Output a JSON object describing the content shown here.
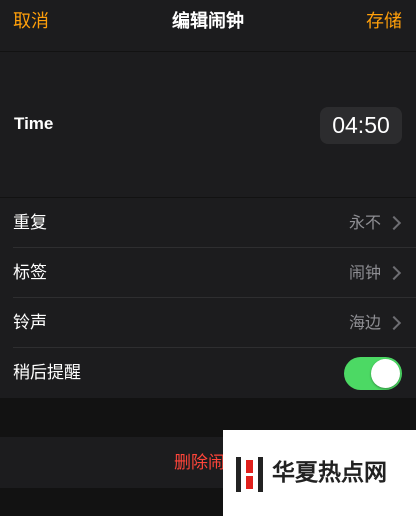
{
  "navbar": {
    "cancel_label": "取消",
    "title": "编辑闹钟",
    "save_label": "存储"
  },
  "time": {
    "label": "Time",
    "value": "04:50"
  },
  "settings": {
    "repeat": {
      "label": "重复",
      "value": "永不"
    },
    "tag": {
      "label": "标签",
      "value": "闹钟"
    },
    "sound": {
      "label": "铃声",
      "value": "海边"
    },
    "snooze": {
      "label": "稍后提醒",
      "enabled": true
    }
  },
  "delete_label": "删除闹钟",
  "watermark": {
    "text": "华夏热点网"
  },
  "colors": {
    "accent": "#ff9f0a",
    "destructive": "#ff453a",
    "toggle_on": "#4cd964",
    "cell_background": "#1c1c1e",
    "page_background": "#121212",
    "secondary_text": "#8e8e93"
  },
  "icons": {
    "disclosure": "chevron-right-icon",
    "watermark_logo": "logo-icon"
  }
}
